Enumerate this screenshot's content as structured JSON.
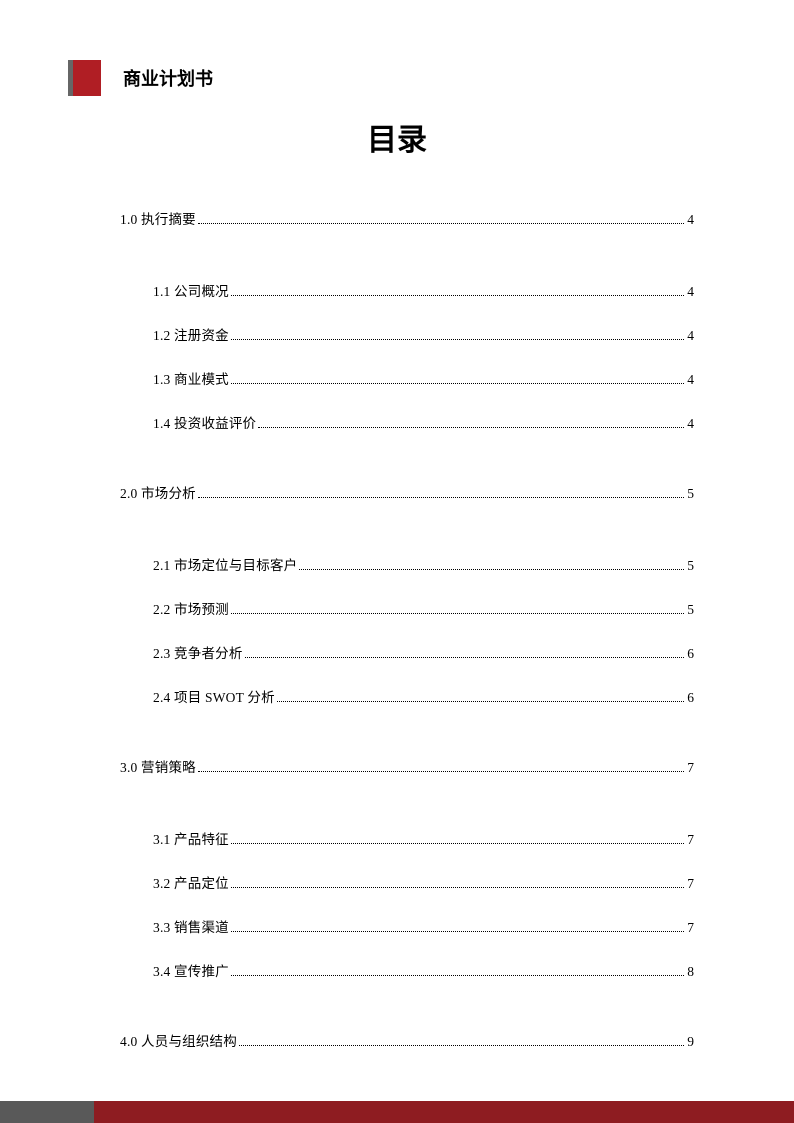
{
  "header": {
    "doc_title": "商业计划书"
  },
  "main_title": "目录",
  "toc": [
    {
      "type": "section",
      "num": "1.0",
      "label": "执行摘要",
      "page": "4"
    },
    {
      "type": "sub",
      "num": "1.1",
      "label": "公司概况",
      "page": "4"
    },
    {
      "type": "sub",
      "num": "1.2",
      "label": "注册资金",
      "page": "4"
    },
    {
      "type": "sub",
      "num": "1.3",
      "label": "商业模式",
      "page": "4"
    },
    {
      "type": "sub",
      "num": "1.4",
      "label": "投资收益评价",
      "page": "4"
    },
    {
      "type": "section",
      "num": "2.0",
      "label": "市场分析",
      "page": "5"
    },
    {
      "type": "sub",
      "num": "2.1",
      "label": "市场定位与目标客户",
      "page": "5"
    },
    {
      "type": "sub",
      "num": "2.2",
      "label": "市场预测",
      "page": "5"
    },
    {
      "type": "sub",
      "num": "2.3",
      "label": " 竞争者分析",
      "page": "6"
    },
    {
      "type": "sub",
      "num": "2.4",
      "label": " 项目 SWOT 分析",
      "page": "6"
    },
    {
      "type": "section",
      "num": "3.0",
      "label": " 营销策略",
      "page": "7"
    },
    {
      "type": "sub",
      "num": "3.1",
      "label": " 产品特征",
      "page": "7"
    },
    {
      "type": "sub",
      "num": "3.2",
      "label": " 产品定位",
      "page": "7"
    },
    {
      "type": "sub",
      "num": "3.3",
      "label": " 销售渠道",
      "page": "7"
    },
    {
      "type": "sub",
      "num": "3.4",
      "label": " 宣传推广",
      "page": "8"
    },
    {
      "type": "section",
      "num": "4.0",
      "label": " 人员与组织结构",
      "page": "9"
    }
  ]
}
